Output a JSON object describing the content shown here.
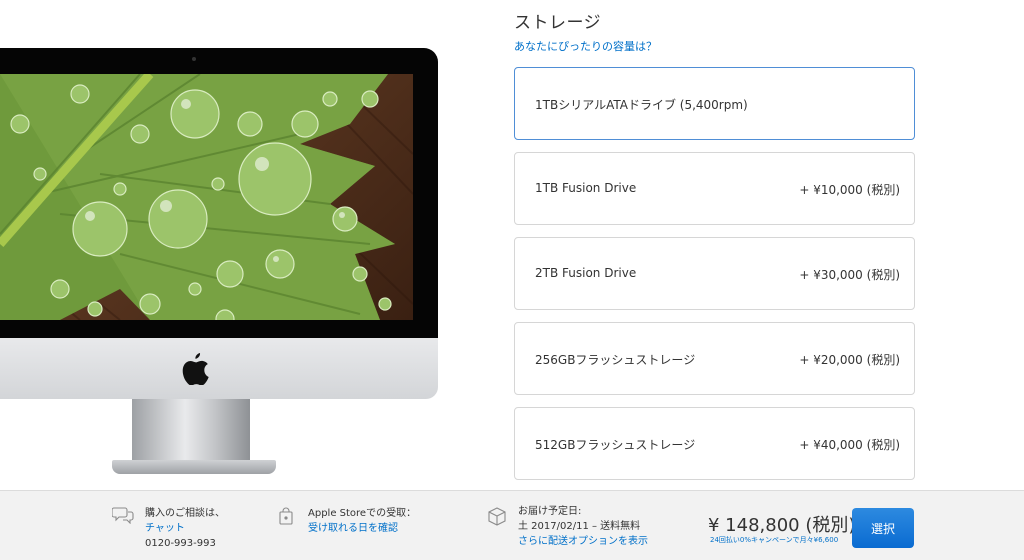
{
  "storage": {
    "title": "ストレージ",
    "help_link": "あなたにぴったりの容量は？",
    "options": [
      {
        "name": "1TBシリアルATAドライブ (5,400rpm)",
        "price": "",
        "selected": true
      },
      {
        "name": "1TB Fusion Drive",
        "price": "+ ¥10,000 (税別)",
        "selected": false
      },
      {
        "name": "2TB Fusion Drive",
        "price": "+ ¥30,000 (税別)",
        "selected": false
      },
      {
        "name": "256GBフラッシュストレージ",
        "price": "+ ¥20,000 (税別)",
        "selected": false
      },
      {
        "name": "512GBフラッシュストレージ",
        "price": "+ ¥40,000 (税別)",
        "selected": false
      }
    ]
  },
  "footer": {
    "consult": {
      "label": "購入のご相談は、",
      "link": "チャット",
      "phone": "0120-993-993",
      "icon": "chat-bubbles-icon"
    },
    "pickup": {
      "label": "Apple Storeでの受取：",
      "link": "受け取れる日を確認",
      "icon": "shopping-bag-icon"
    },
    "delivery": {
      "label": "お届け予定日:",
      "date": "土 2017/02/11 – 送料無料",
      "link": "さらに配送オプションを表示",
      "icon": "package-box-icon"
    },
    "price": "¥ 148,800 (税別)",
    "price_note": "24回払い0%キャンペーンで月々¥6,600",
    "select_label": "選択"
  },
  "colors": {
    "link": "#0070c9",
    "selected_border": "#4f8ed6",
    "button": "#1a7adb",
    "footer_bg": "#f2f2f2"
  }
}
